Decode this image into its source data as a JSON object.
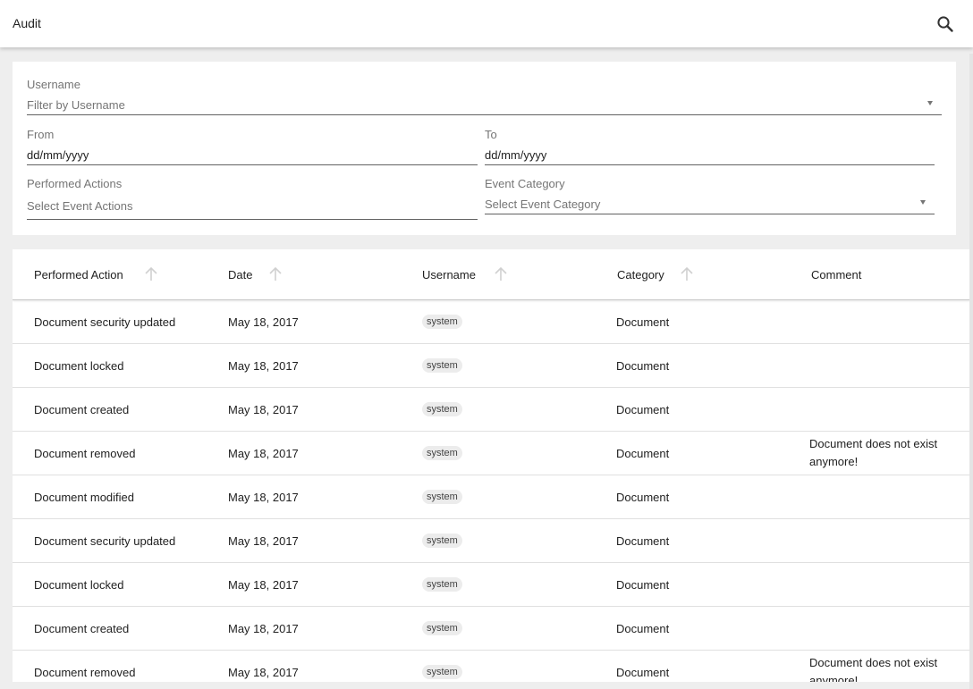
{
  "appbar": {
    "title": "Audit",
    "search_icon": "search-icon"
  },
  "filters": {
    "username": {
      "label": "Username",
      "placeholder": "Filter by Username"
    },
    "from": {
      "label": "From",
      "value": "dd/mm/yyyy"
    },
    "to": {
      "label": "To",
      "value": "dd/mm/yyyy"
    },
    "actions": {
      "label": "Performed Actions",
      "placeholder": "Select Event Actions"
    },
    "category": {
      "label": "Event Category",
      "placeholder": "Select Event Category"
    }
  },
  "table": {
    "columns": [
      "Performed Action",
      "Date",
      "Username",
      "Category",
      "Comment"
    ],
    "rows": [
      {
        "action": "Document security updated",
        "date": "May 18, 2017",
        "user": "system",
        "category": "Document",
        "comment": ""
      },
      {
        "action": "Document locked",
        "date": "May 18, 2017",
        "user": "system",
        "category": "Document",
        "comment": ""
      },
      {
        "action": "Document created",
        "date": "May 18, 2017",
        "user": "system",
        "category": "Document",
        "comment": ""
      },
      {
        "action": "Document removed",
        "date": "May 18, 2017",
        "user": "system",
        "category": "Document",
        "comment": "Document does not exist anymore!"
      },
      {
        "action": "Document modified",
        "date": "May 18, 2017",
        "user": "system",
        "category": "Document",
        "comment": ""
      },
      {
        "action": "Document security updated",
        "date": "May 18, 2017",
        "user": "system",
        "category": "Document",
        "comment": ""
      },
      {
        "action": "Document locked",
        "date": "May 18, 2017",
        "user": "system",
        "category": "Document",
        "comment": ""
      },
      {
        "action": "Document created",
        "date": "May 18, 2017",
        "user": "system",
        "category": "Document",
        "comment": ""
      },
      {
        "action": "Document removed",
        "date": "May 18, 2017",
        "user": "system",
        "category": "Document",
        "comment": "Document does not exist anymore!"
      }
    ]
  },
  "colors": {
    "background": "#eeeeee",
    "surface": "#ffffff",
    "chip": "#ececec",
    "muted": "#757575"
  }
}
